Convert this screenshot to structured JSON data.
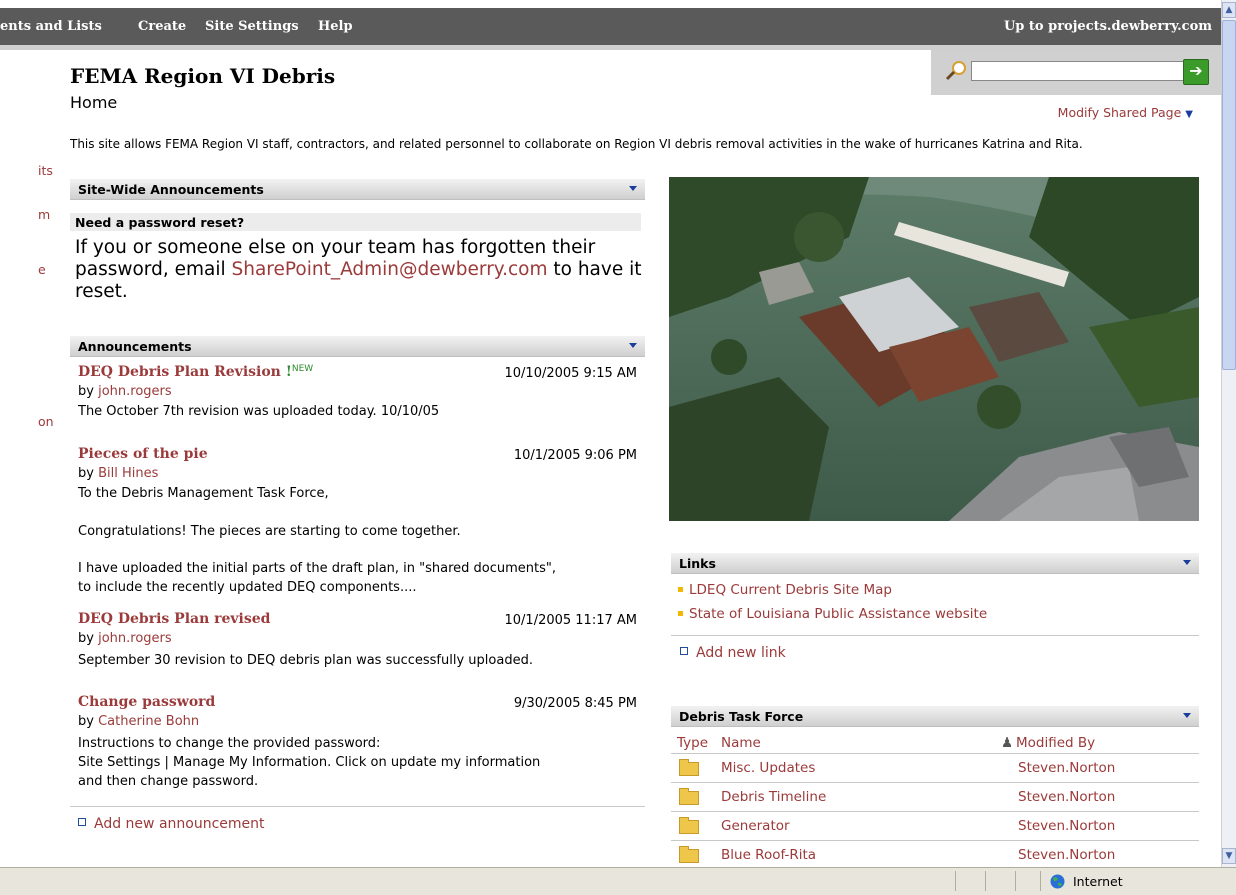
{
  "topnav": {
    "items": [
      "ents and Lists",
      "Create",
      "Site Settings",
      "Help"
    ],
    "up_link": "Up to projects.dewberry.com"
  },
  "header": {
    "site_title": "FEMA Region VI Debris",
    "page_name": "Home",
    "modify_label": "Modify Shared Page",
    "search_value": ""
  },
  "leftnav": {
    "items": [
      "its",
      "m",
      "e",
      "on"
    ]
  },
  "description": "This site allows FEMA Region VI staff, contractors, and related personnel to collaborate on Region VI debris removal activities in the wake of hurricanes Katrina and Rita.",
  "site_wide": {
    "title": "Site-Wide Announcements",
    "item_title": "Need a password reset?",
    "body_before": "If you or someone else on your team has forgotten their password, email ",
    "email": "SharePoint_Admin@dewberry.com",
    "body_after": " to have it reset."
  },
  "announcements": {
    "title": "Announcements",
    "new_badge": "NEW",
    "items": [
      {
        "title": "DEQ Debris Plan Revision",
        "date": "10/10/2005 9:15 AM",
        "by": "by ",
        "author": "john.rogers",
        "lines": [
          "The October 7th revision was uploaded today. 10/10/05"
        ]
      },
      {
        "title": "Pieces of the pie",
        "date": "10/1/2005 9:06 PM",
        "by": "by ",
        "author": "Bill Hines",
        "lines": [
          "To the Debris Management Task Force,",
          "Congratulations! The pieces are starting to come together.",
          "I have uploaded the initial parts of the draft plan, in \"shared documents\",",
          "to include the recently updated DEQ components...."
        ]
      },
      {
        "title": "DEQ Debris Plan revised",
        "date": "10/1/2005 11:17 AM",
        "by": "by ",
        "author": "john.rogers",
        "lines": [
          "September 30 revision to DEQ debris plan was successfully uploaded."
        ]
      },
      {
        "title": "Change password",
        "date": "9/30/2005 8:45 PM",
        "by": "by ",
        "author": "Catherine Bohn",
        "lines": [
          "Instructions to change the provided password:",
          "Site Settings | Manage My Information.  Click on update my information",
          "and then change password."
        ]
      }
    ],
    "add_label": "Add new announcement"
  },
  "links": {
    "title": "Links",
    "items": [
      "LDEQ Current Debris Site Map",
      "State of Louisiana Public Assistance website"
    ],
    "add_label": "Add new link"
  },
  "task_force": {
    "title": "Debris Task Force",
    "col_type": "Type",
    "col_name": "Name",
    "col_modified": "Modified By",
    "rows": [
      {
        "name": "Misc. Updates",
        "modified_by": "Steven.Norton"
      },
      {
        "name": "Debris Timeline",
        "modified_by": "Steven.Norton"
      },
      {
        "name": "Generator",
        "modified_by": "Steven.Norton"
      },
      {
        "name": "Blue Roof-Rita",
        "modified_by": "Steven.Norton"
      }
    ]
  },
  "statusbar": {
    "zone": "Internet"
  },
  "colors": {
    "link": "#9b3a3a",
    "topbar": "#5a5a5a",
    "accent_blue": "#1a3e9a"
  }
}
